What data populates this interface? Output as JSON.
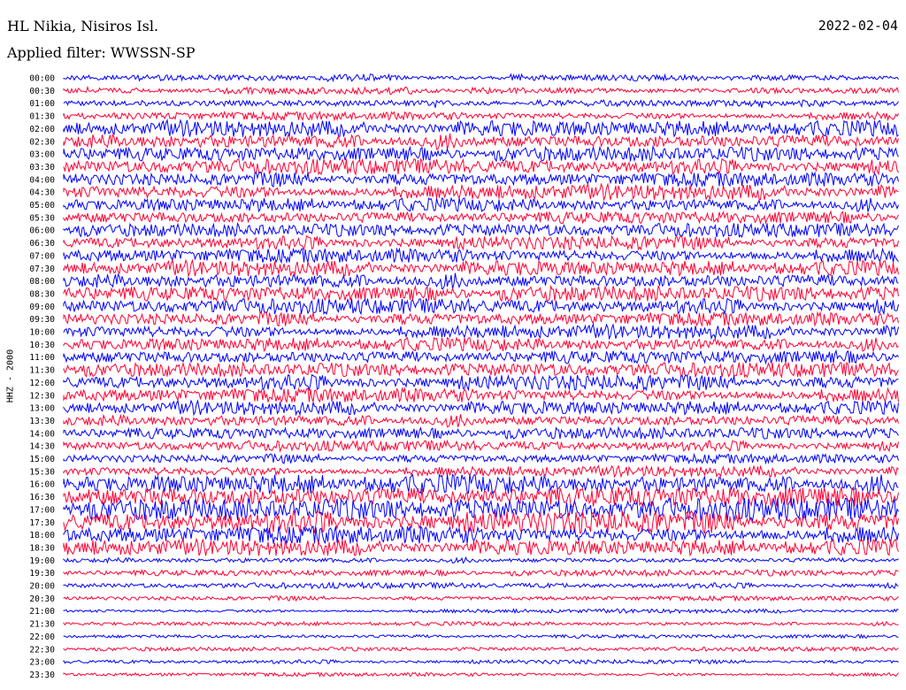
{
  "header": {
    "station": "HL Nikia, Nisiros Isl.",
    "filter": "Applied filter: WWSSN-SP",
    "date": "2022-02-04"
  },
  "chart_data": {
    "type": "line",
    "title": "HL Nikia, Nisiros Isl.",
    "subtitle": "Applied filter: WWSSN-SP",
    "ylabel": "HHZ - 2000",
    "xlabel": "",
    "date": "2022-02-04",
    "rows": [
      "00:00",
      "00:30",
      "01:00",
      "01:30",
      "02:00",
      "02:30",
      "03:00",
      "03:30",
      "04:00",
      "04:30",
      "05:00",
      "05:30",
      "06:00",
      "06:30",
      "07:00",
      "07:30",
      "08:00",
      "08:30",
      "09:00",
      "09:30",
      "10:00",
      "10:30",
      "11:00",
      "11:30",
      "12:00",
      "12:30",
      "13:00",
      "13:30",
      "14:00",
      "14:30",
      "15:00",
      "15:30",
      "16:00",
      "16:30",
      "17:00",
      "17:30",
      "18:00",
      "18:30",
      "19:00",
      "19:30",
      "20:00",
      "20:30",
      "21:00",
      "21:30",
      "22:00",
      "22:30",
      "23:00",
      "23:30"
    ],
    "amplitude": [
      0.45,
      0.45,
      0.45,
      0.55,
      1.0,
      1.0,
      0.95,
      0.95,
      0.95,
      0.95,
      0.85,
      0.85,
      0.85,
      0.85,
      0.95,
      0.95,
      1.0,
      1.0,
      0.95,
      0.9,
      0.85,
      0.85,
      0.9,
      0.9,
      0.95,
      0.95,
      0.85,
      0.8,
      0.75,
      0.65,
      0.6,
      0.65,
      1.2,
      1.4,
      1.4,
      1.4,
      1.2,
      1.0,
      0.35,
      0.4,
      0.35,
      0.3,
      0.25,
      0.25,
      0.25,
      0.25,
      0.25,
      0.25
    ],
    "colors": [
      "#0000ff",
      "#ff0033"
    ],
    "grid": false
  }
}
